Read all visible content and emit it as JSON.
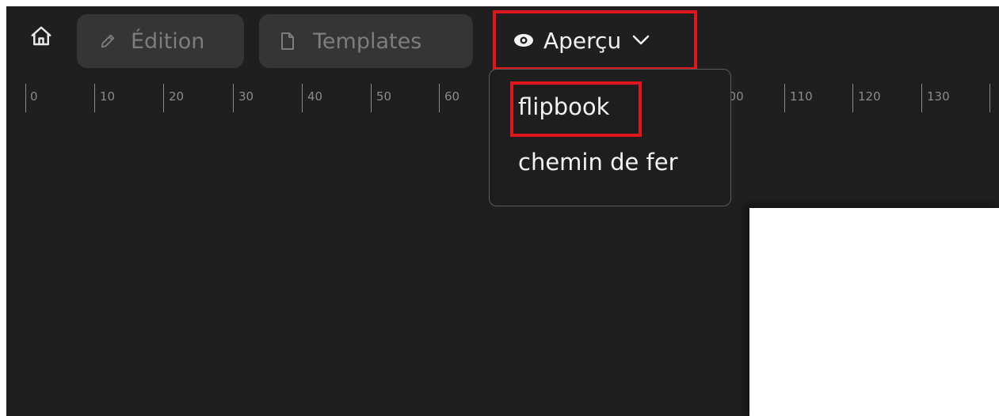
{
  "toolbar": {
    "home_icon": "home-icon",
    "edition": {
      "label": "Édition",
      "icon": "pencil-icon"
    },
    "templates": {
      "label": "Templates",
      "icon": "document-icon"
    },
    "apercu": {
      "label": "Aperçu",
      "icon": "eye-icon",
      "chevron": "chevron-down-icon"
    }
  },
  "ruler": {
    "ticks": [
      "0",
      "10",
      "20",
      "30",
      "40",
      "50",
      "60",
      "",
      "",
      "",
      "100",
      "110",
      "120",
      "130",
      ""
    ]
  },
  "dropdown": {
    "items": [
      "flipbook",
      "chemin de fer"
    ]
  },
  "colors": {
    "background": "#1f1f1f",
    "button": "#353535",
    "highlight": "#e0161c",
    "page": "#ffffff"
  }
}
